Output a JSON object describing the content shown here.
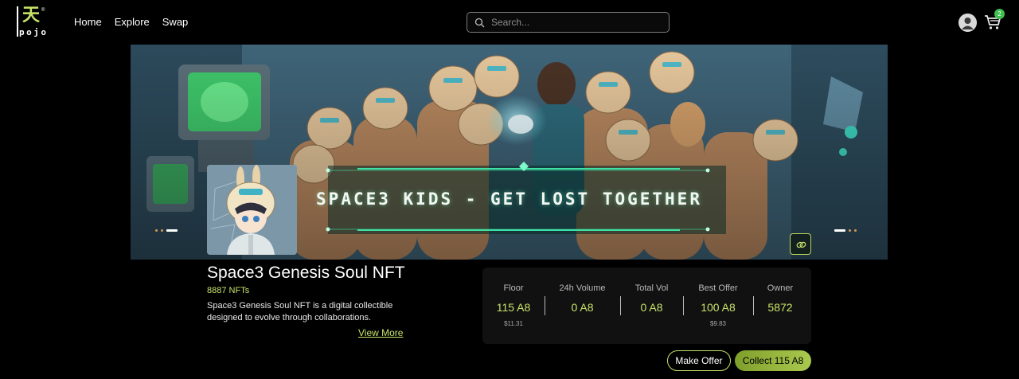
{
  "header": {
    "logo_word": "pojo",
    "nav": [
      {
        "label": "Home"
      },
      {
        "label": "Explore"
      },
      {
        "label": "Swap"
      }
    ],
    "search": {
      "placeholder": "Search..."
    },
    "cart_count": "2",
    "icons": [
      "search-icon",
      "user-icon",
      "cart-icon"
    ]
  },
  "banner": {
    "title": "SPACE3 KIDS - GET LOST TOGETHER",
    "icons": [
      "link-icon"
    ]
  },
  "collection": {
    "name": "Space3 Genesis Soul NFT",
    "count": "8887 NFTs",
    "description": "Space3 Genesis Soul NFT is a digital collectible designed to evolve through collaborations.",
    "view_more": "View More"
  },
  "stats": [
    {
      "label": "Floor",
      "value": "115 A8",
      "sub": "$11.31"
    },
    {
      "label": "24h Volume",
      "value": "0 A8",
      "sub": ""
    },
    {
      "label": "Total Vol",
      "value": "0 A8",
      "sub": ""
    },
    {
      "label": "Best Offer",
      "value": "100 A8",
      "sub": "$9.83"
    },
    {
      "label": "Owner",
      "value": "5872",
      "sub": ""
    }
  ],
  "actions": {
    "make_offer": "Make Offer",
    "collect": "Collect 115 A8"
  },
  "colors": {
    "accent": "#c7e36b",
    "background": "#000000",
    "panel": "#111111",
    "badge": "#3fbf4f"
  }
}
